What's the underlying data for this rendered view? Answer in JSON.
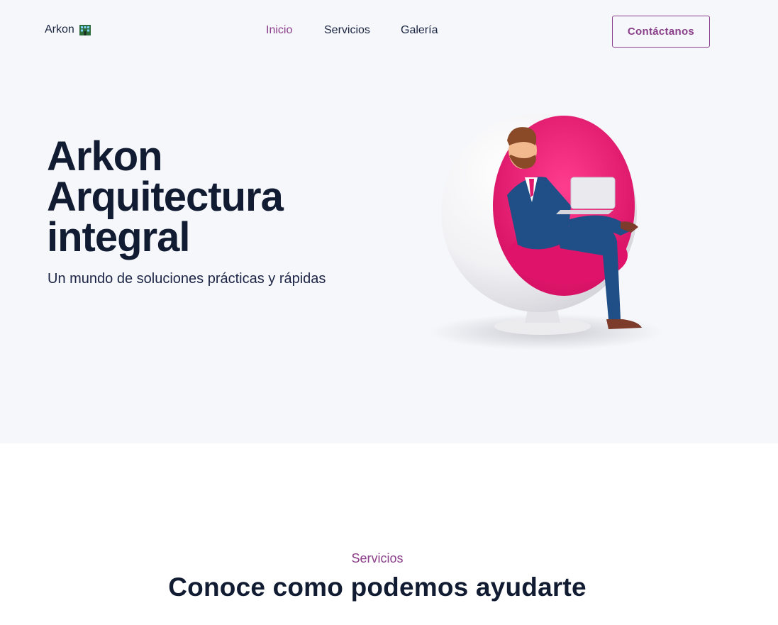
{
  "header": {
    "logo_text": "Arkon",
    "logo_icon": "office-building-icon",
    "nav": [
      {
        "label": "Inicio",
        "active": true
      },
      {
        "label": "Servicios",
        "active": false
      },
      {
        "label": "Galería",
        "active": false
      }
    ],
    "cta_label": "Contáctanos"
  },
  "hero": {
    "title_line1": "Arkon",
    "title_line2": "Arquitectura",
    "title_line3": "integral",
    "subtitle": "Un mundo de soluciones prácticas y rápidas",
    "illustration": "man-in-egg-chair-with-laptop"
  },
  "services": {
    "kicker": "Servicios",
    "title": "Conoce como podemos ayudarte"
  },
  "colors": {
    "accent": "#8b3f8a",
    "heading": "#111b31",
    "hero_bg": "#f6f7fb",
    "chair_pink": "#e8116d"
  }
}
